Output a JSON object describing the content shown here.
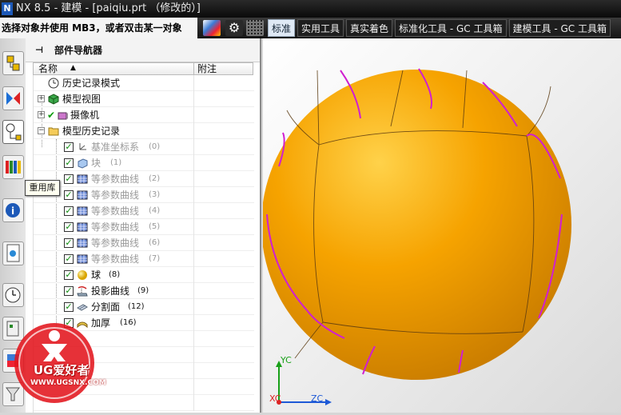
{
  "window": {
    "title": "NX 8.5 - 建模 - [paiqiu.prt （修改的）]"
  },
  "statusbar": {
    "prompt": "选择对象并使用 MB3，或者双击某一对象",
    "tabs": [
      "标准",
      "实用工具",
      "真实着色",
      "标准化工具 - GC 工具箱",
      "建模工具 - GC 工具箱"
    ],
    "active_tab": "标准"
  },
  "tooltip": {
    "text": "重用库"
  },
  "navigator": {
    "title": "部件导航器",
    "columns": {
      "name": "名称",
      "note": "附注"
    },
    "rows": [
      {
        "label": "历史记录模式",
        "num": ""
      },
      {
        "label": "模型视图",
        "num": ""
      },
      {
        "label": "摄像机",
        "num": ""
      },
      {
        "label": "模型历史记录",
        "num": ""
      },
      {
        "label": "基准坐标系",
        "num": "(0)"
      },
      {
        "label": "块",
        "num": "(1)"
      },
      {
        "label": "等参数曲线",
        "num": "(2)"
      },
      {
        "label": "等参数曲线",
        "num": "(3)"
      },
      {
        "label": "等参数曲线",
        "num": "(4)"
      },
      {
        "label": "等参数曲线",
        "num": "(5)"
      },
      {
        "label": "等参数曲线",
        "num": "(6)"
      },
      {
        "label": "等参数曲线",
        "num": "(7)"
      },
      {
        "label": "球",
        "num": "(8)"
      },
      {
        "label": "投影曲线",
        "num": "(9)"
      },
      {
        "label": "分割面",
        "num": "(12)"
      },
      {
        "label": "加厚",
        "num": "(16)"
      }
    ]
  },
  "viewport": {
    "axes": {
      "y": "YC",
      "x": "XC",
      "z": "ZC"
    },
    "ball_color": "#f6a300",
    "curve_color": "#d01fd0"
  },
  "watermark": {
    "brand": "UG爱好者",
    "url": "WWW.UGSNX.COM"
  }
}
